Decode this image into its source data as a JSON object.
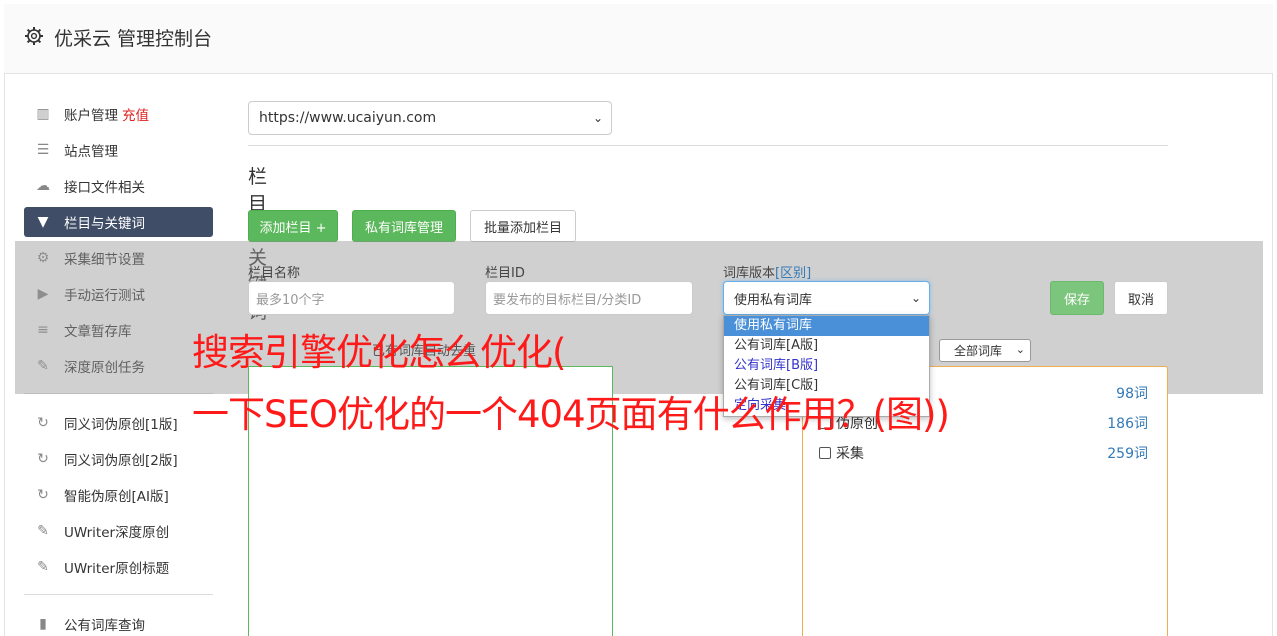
{
  "header": {
    "title": "优采云 管理控制台"
  },
  "sidebar": {
    "items": [
      {
        "label": "账户管理",
        "badge": "充值",
        "icon": "bar-chart-icon"
      },
      {
        "label": "站点管理",
        "icon": "server-icon"
      },
      {
        "label": "接口文件相关",
        "icon": "cloud-upload-icon"
      },
      {
        "label": "栏目与关键词",
        "icon": "filter-icon",
        "active": true
      },
      {
        "label": "采集细节设置",
        "icon": "gears-icon"
      },
      {
        "label": "手动运行测试",
        "icon": "play-circle-icon"
      },
      {
        "label": "文章暂存库",
        "icon": "database-icon"
      },
      {
        "label": "深度原创任务",
        "icon": "edit-icon"
      },
      {
        "label": "同义词伪原创[1版]",
        "icon": "refresh-icon"
      },
      {
        "label": "同义词伪原创[2版]",
        "icon": "refresh-icon"
      },
      {
        "label": "智能伪原创[AI版]",
        "icon": "refresh-icon"
      },
      {
        "label": "UWriter深度原创",
        "icon": "edit-icon"
      },
      {
        "label": "UWriter原创标题",
        "icon": "edit-icon"
      },
      {
        "label": "公有词库查询",
        "icon": "book-icon"
      }
    ]
  },
  "main": {
    "site_select": "https://www.ucaiyun.com",
    "section_title": "栏目与关键词",
    "buttons": {
      "add_column": "添加栏目 +",
      "private_lib": "私有词库管理",
      "batch_add": "批量添加栏目"
    },
    "form": {
      "name_label": "栏目名称",
      "name_placeholder": "最多10个字",
      "id_label": "栏目ID",
      "id_placeholder": "要发布的目标栏目/分类ID",
      "lib_label": "词库版本",
      "lib_link": "[区别]",
      "lib_value": "使用私有词库",
      "options": [
        "使用私有词库",
        "公有词库[A版]",
        "公有词库[B版]",
        "公有词库[C版]",
        "定向采集"
      ],
      "save": "保存",
      "cancel": "取消"
    },
    "hint": "已有词库自动去重",
    "lib_filter": "全部词库",
    "lists": [
      {
        "label": "",
        "count": "98词"
      },
      {
        "label": "伪原创",
        "count": "186词"
      },
      {
        "label": "采集",
        "count": "259词"
      }
    ]
  },
  "watermark": {
    "line1": "搜索引擎优化怎么优化(",
    "line2": "一下SEO优化的一个404页面有什么作用？(图))"
  },
  "colors": {
    "accent": "#3f4d67",
    "green": "#5cb85c",
    "red": "#ff1a1a",
    "link": "#337ab7"
  }
}
